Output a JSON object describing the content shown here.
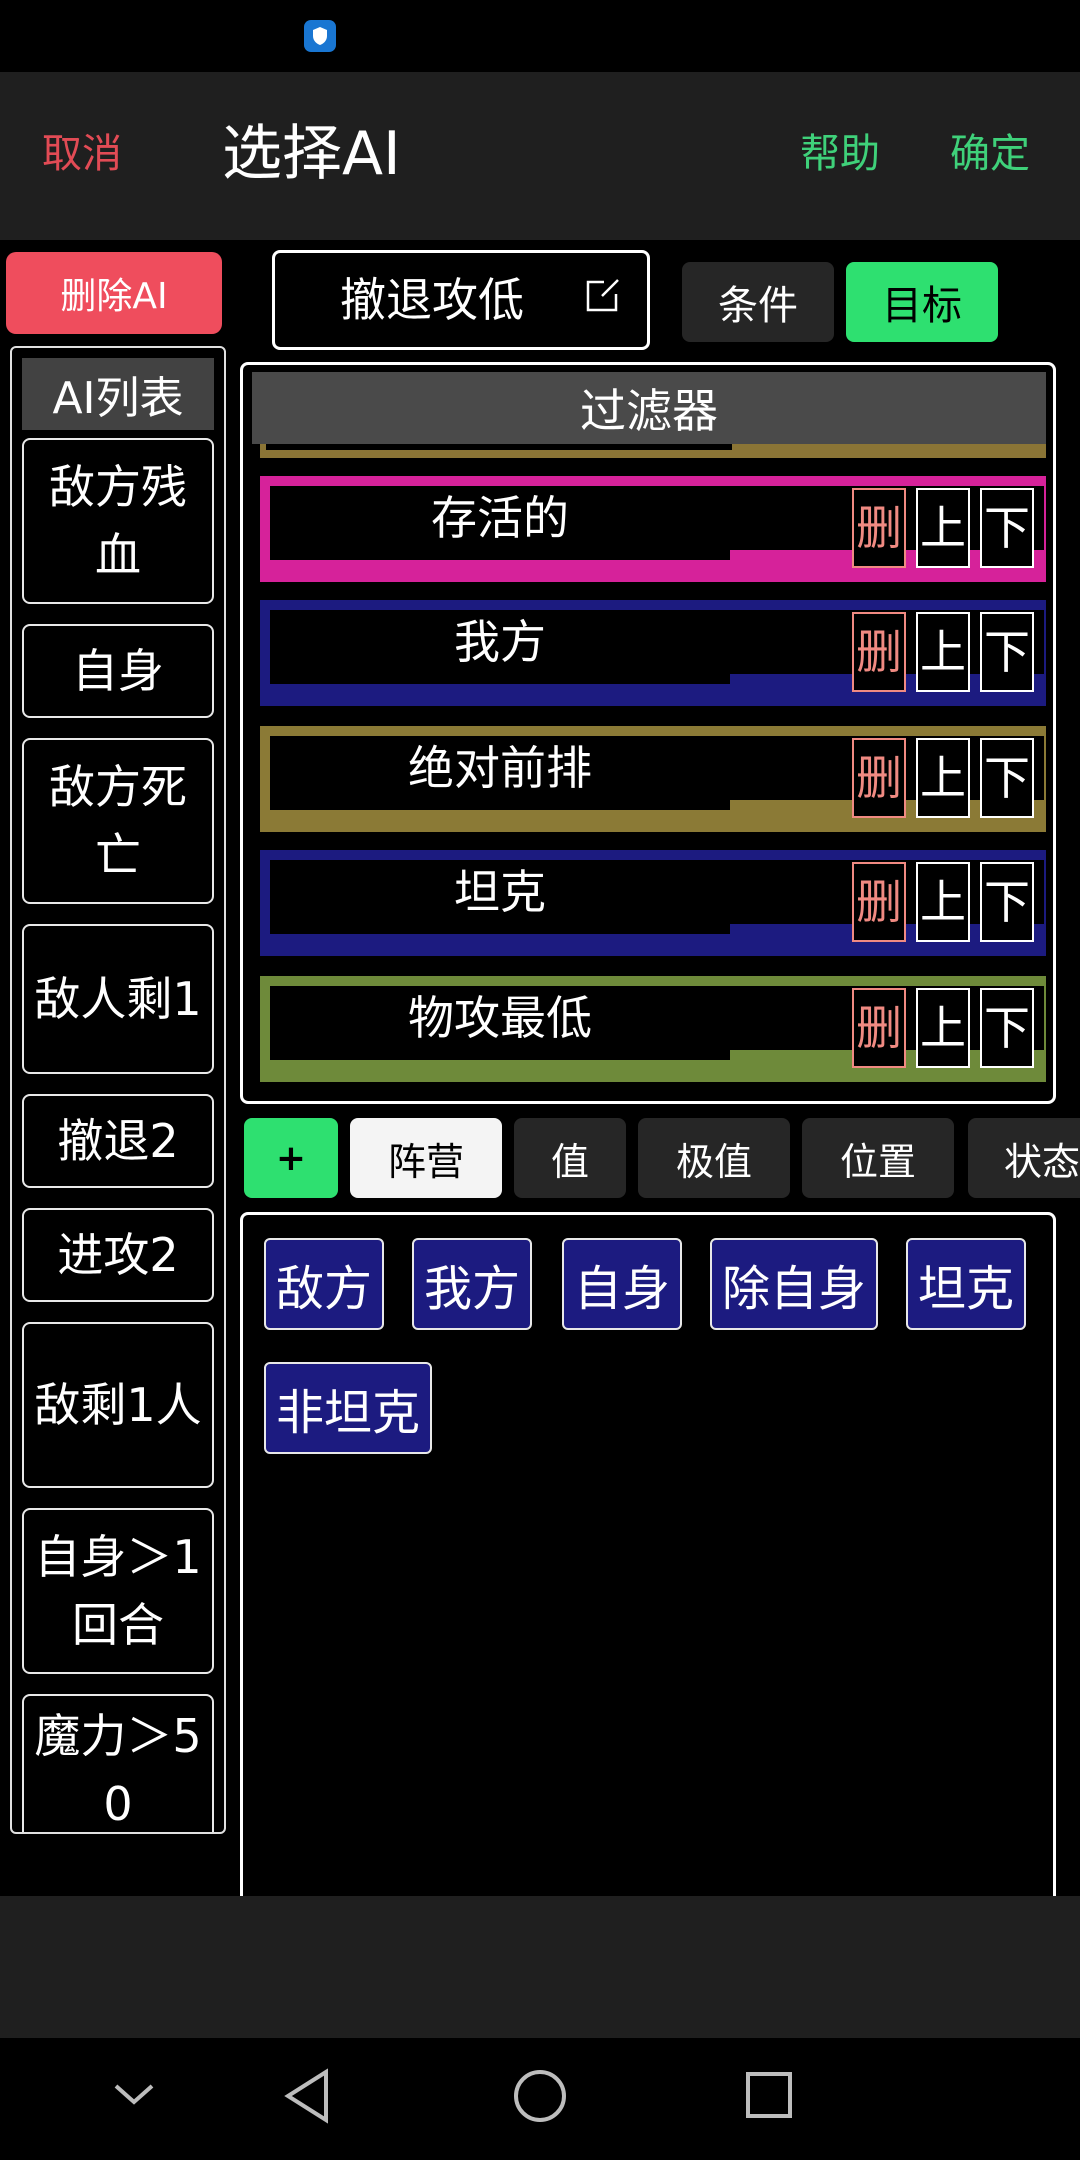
{
  "header": {
    "cancel": "取消",
    "title": "选择AI",
    "help": "帮助",
    "confirm": "确定"
  },
  "left": {
    "delete_ai": "删除AI",
    "list_title": "AI列表",
    "items": [
      "敌方残血",
      "自身",
      "敌方死亡",
      "敌人剩1",
      "撤退2",
      "进攻2",
      "敌剩1人",
      "自身＞1回合",
      "魔力＞50"
    ]
  },
  "ai_name": "撤退攻低",
  "tabs": {
    "condition": "条件",
    "target": "目标"
  },
  "filter": {
    "title": "过滤器",
    "rows": [
      {
        "label": "存活的",
        "color": "#d6229a"
      },
      {
        "label": "我方",
        "color": "#1c1b80"
      },
      {
        "label": "绝对前排",
        "color": "#8b7a36"
      },
      {
        "label": "坦克",
        "color": "#1c1b80"
      },
      {
        "label": "物攻最低",
        "color": "#6e8a3a"
      }
    ],
    "del": "删",
    "up": "上",
    "down": "下"
  },
  "categories": {
    "add": "+",
    "items": [
      "阵营",
      "值",
      "极值",
      "位置",
      "状态"
    ],
    "active": "阵营"
  },
  "options": [
    "敌方",
    "我方",
    "自身",
    "除自身",
    "坦克",
    "非坦克"
  ],
  "colors": {
    "accent_green": "#2ee070",
    "cancel_red": "#e24b55",
    "delete_red": "#ef4d5d",
    "option_blue": "#1c1b80"
  }
}
